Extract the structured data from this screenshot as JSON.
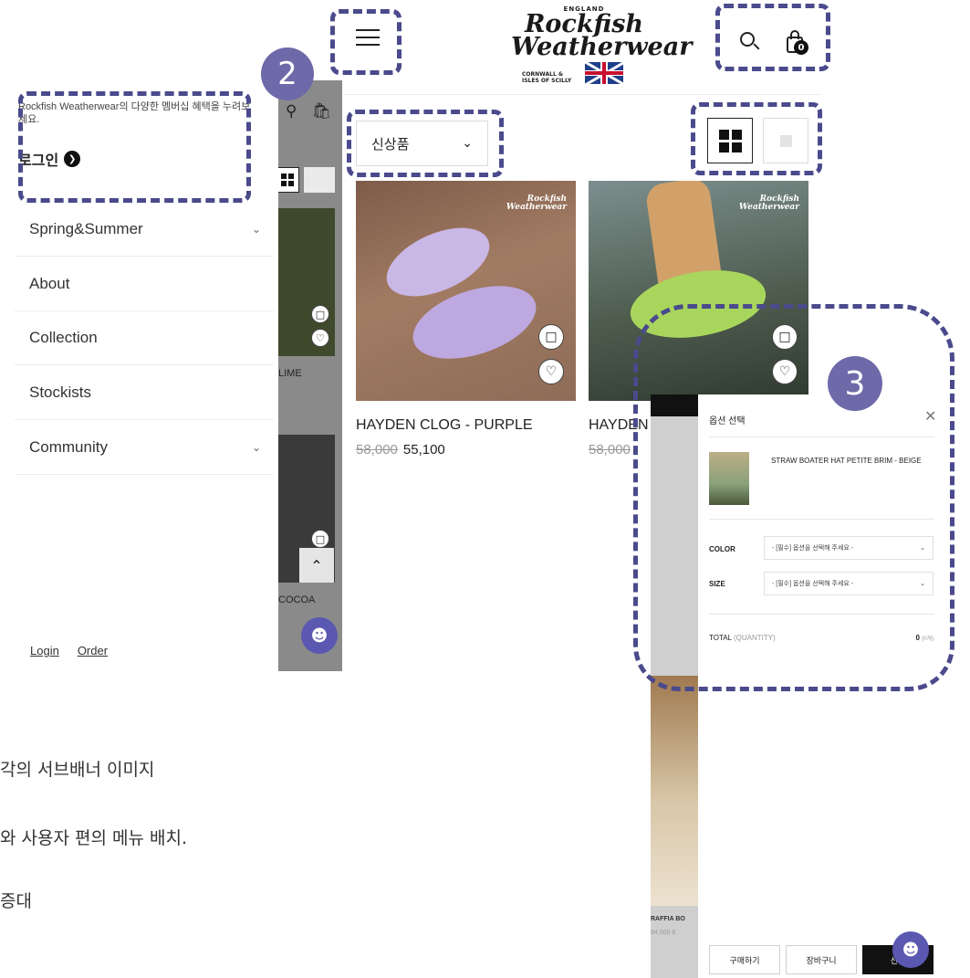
{
  "drawer": {
    "promo": "Rockfish Weatherwear의 다양한 멤버십 혜택을 누려보세요.",
    "login_title": "로그인",
    "menu": [
      {
        "label": "Spring&Summer",
        "has_children": true
      },
      {
        "label": "About",
        "has_children": false
      },
      {
        "label": "Collection",
        "has_children": false
      },
      {
        "label": "Stockists",
        "has_children": false
      },
      {
        "label": "Community",
        "has_children": true
      }
    ],
    "footer": {
      "login": "Login",
      "order": "Order"
    },
    "bg_labels": [
      "LIME",
      "COCOA"
    ]
  },
  "annotations": {
    "badge_2": "2",
    "badge_3": "3"
  },
  "header": {
    "logo": {
      "top": "ENGLAND",
      "line1": "Rockfish",
      "line2": "Weatherwear",
      "sub1": "CORNWALL &",
      "sub2": "ISLES OF SCILLY"
    },
    "cart_count": "0",
    "side_cart_count": "0"
  },
  "toolbar": {
    "sort_selected": "신상품"
  },
  "products": [
    {
      "name": "HAYDEN CLOG - PURPLE",
      "old_price": "58,000",
      "price": "55,100"
    },
    {
      "name": "HAYDEN",
      "old_price": "58,000",
      "price": ""
    }
  ],
  "image_logo": {
    "line1": "Rockfish",
    "line2": "Weatherwear"
  },
  "modal": {
    "title": "옵션 선택",
    "product_name": "STRAW BOATER HAT PETITE BRIM - BEIGE",
    "options": [
      {
        "label": "COLOR",
        "placeholder": "- [필수] 옵션을 선택해 주세요 -"
      },
      {
        "label": "SIZE",
        "placeholder": "- [필수] 옵션을 선택해 주세요 -"
      }
    ],
    "total_label": "TOTAL",
    "total_qty_label": "(QUANTITY)",
    "total_value": "0",
    "total_count": "(0개)",
    "buttons": {
      "buy": "구매하기",
      "cart": "장바구니",
      "gift": "선물"
    },
    "bg_label": "RAFFIA BO",
    "bg_price": "84,000  8"
  },
  "captions": [
    "각의 서브배너 이미지",
    "와 사용자 편의 메뉴 배치.",
    "증대"
  ],
  "colors": {
    "annotation": "#4a4a8c",
    "badge": "#6e69a8",
    "chat": "#5a58b0"
  }
}
